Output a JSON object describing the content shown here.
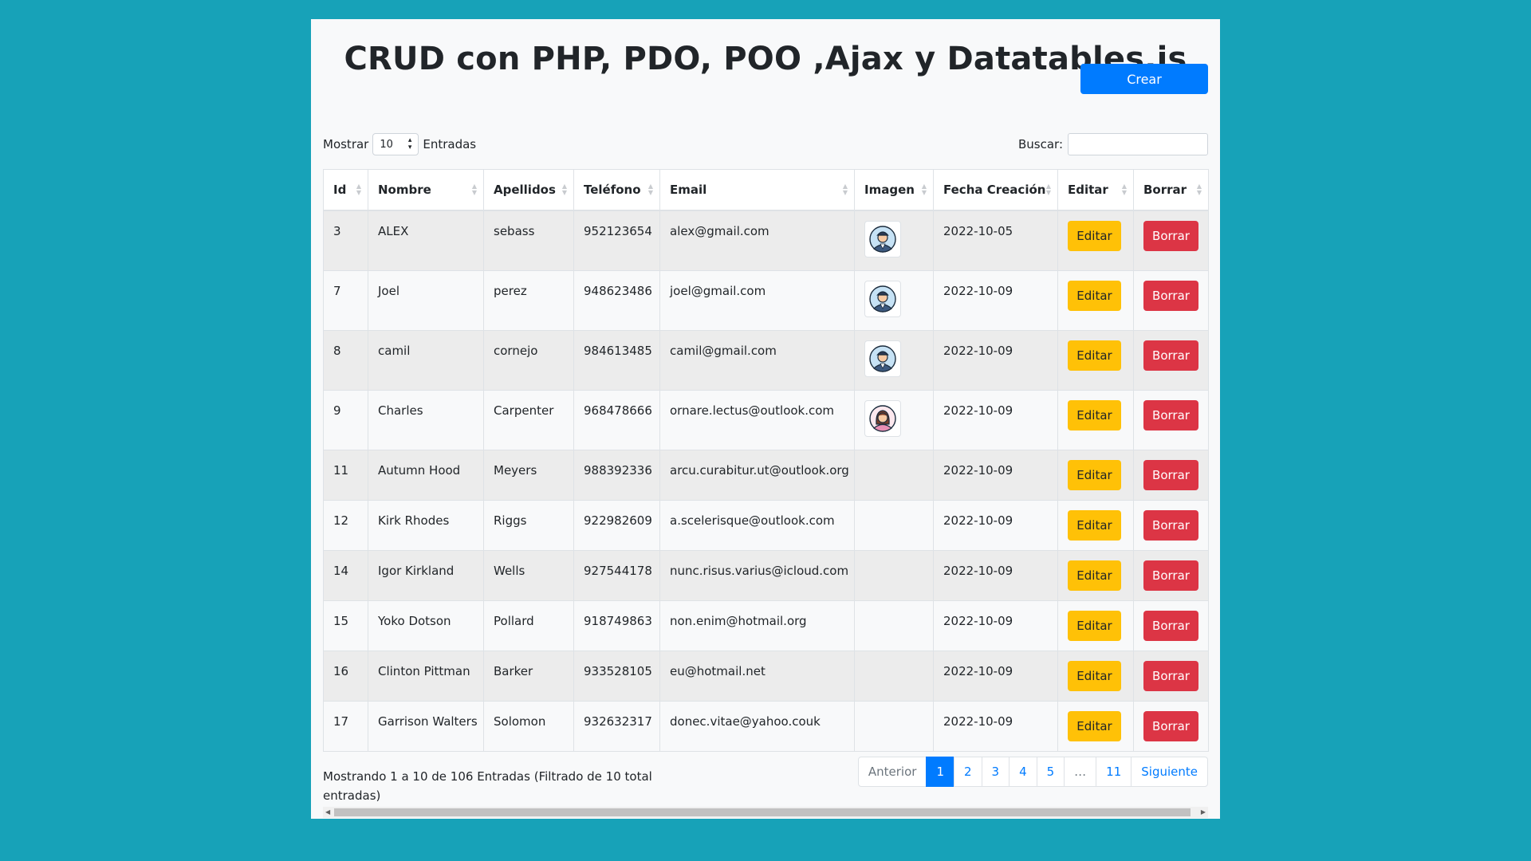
{
  "page": {
    "title": "CRUD con PHP, PDO, POO ,Ajax y Datatables.js",
    "create_label": "Crear"
  },
  "length_control": {
    "prefix": "Mostrar",
    "value": "10",
    "suffix": "Entradas"
  },
  "search": {
    "label": "Buscar:",
    "value": ""
  },
  "table": {
    "columns": [
      "Id",
      "Nombre",
      "Apellidos",
      "Teléfono",
      "Email",
      "Imagen",
      "Fecha Creación",
      "Editar",
      "Borrar"
    ],
    "edit_label": "Editar",
    "delete_label": "Borrar",
    "rows": [
      {
        "id": "3",
        "nombre": "ALEX",
        "apellidos": "sebass",
        "telefono": "952123654",
        "email": "alex@gmail.com",
        "imagen": "male-avatar-icon",
        "fecha": "2022-10-05"
      },
      {
        "id": "7",
        "nombre": "Joel",
        "apellidos": "perez",
        "telefono": "948623486",
        "email": "joel@gmail.com",
        "imagen": "male-avatar-icon",
        "fecha": "2022-10-09"
      },
      {
        "id": "8",
        "nombre": "camil",
        "apellidos": "cornejo",
        "telefono": "984613485",
        "email": "camil@gmail.com",
        "imagen": "male-avatar-icon",
        "fecha": "2022-10-09"
      },
      {
        "id": "9",
        "nombre": "Charles",
        "apellidos": "Carpenter",
        "telefono": "968478666",
        "email": "ornare.lectus@outlook.com",
        "imagen": "female-avatar-icon",
        "fecha": "2022-10-09"
      },
      {
        "id": "11",
        "nombre": "Autumn Hood",
        "apellidos": "Meyers",
        "telefono": "988392336",
        "email": "arcu.curabitur.ut@outlook.org",
        "imagen": "",
        "fecha": "2022-10-09"
      },
      {
        "id": "12",
        "nombre": "Kirk Rhodes",
        "apellidos": "Riggs",
        "telefono": "922982609",
        "email": "a.scelerisque@outlook.com",
        "imagen": "",
        "fecha": "2022-10-09"
      },
      {
        "id": "14",
        "nombre": "Igor Kirkland",
        "apellidos": "Wells",
        "telefono": "927544178",
        "email": "nunc.risus.varius@icloud.com",
        "imagen": "",
        "fecha": "2022-10-09"
      },
      {
        "id": "15",
        "nombre": "Yoko Dotson",
        "apellidos": "Pollard",
        "telefono": "918749863",
        "email": "non.enim@hotmail.org",
        "imagen": "",
        "fecha": "2022-10-09"
      },
      {
        "id": "16",
        "nombre": "Clinton Pittman",
        "apellidos": "Barker",
        "telefono": "933528105",
        "email": "eu@hotmail.net",
        "imagen": "",
        "fecha": "2022-10-09"
      },
      {
        "id": "17",
        "nombre": "Garrison Walters",
        "apellidos": "Solomon",
        "telefono": "932632317",
        "email": "donec.vitae@yahoo.couk",
        "imagen": "",
        "fecha": "2022-10-09"
      }
    ]
  },
  "info": "Mostrando 1 a 10 de 106 Entradas (Filtrado de 10 total entradas)",
  "pagination": {
    "previous": "Anterior",
    "pages": [
      "1",
      "2",
      "3",
      "4",
      "5",
      "…",
      "11"
    ],
    "active": "1",
    "next": "Siguiente"
  },
  "colors": {
    "background": "#17a2b8",
    "primary": "#007bff",
    "warning": "#ffc107",
    "danger": "#dc3545"
  }
}
